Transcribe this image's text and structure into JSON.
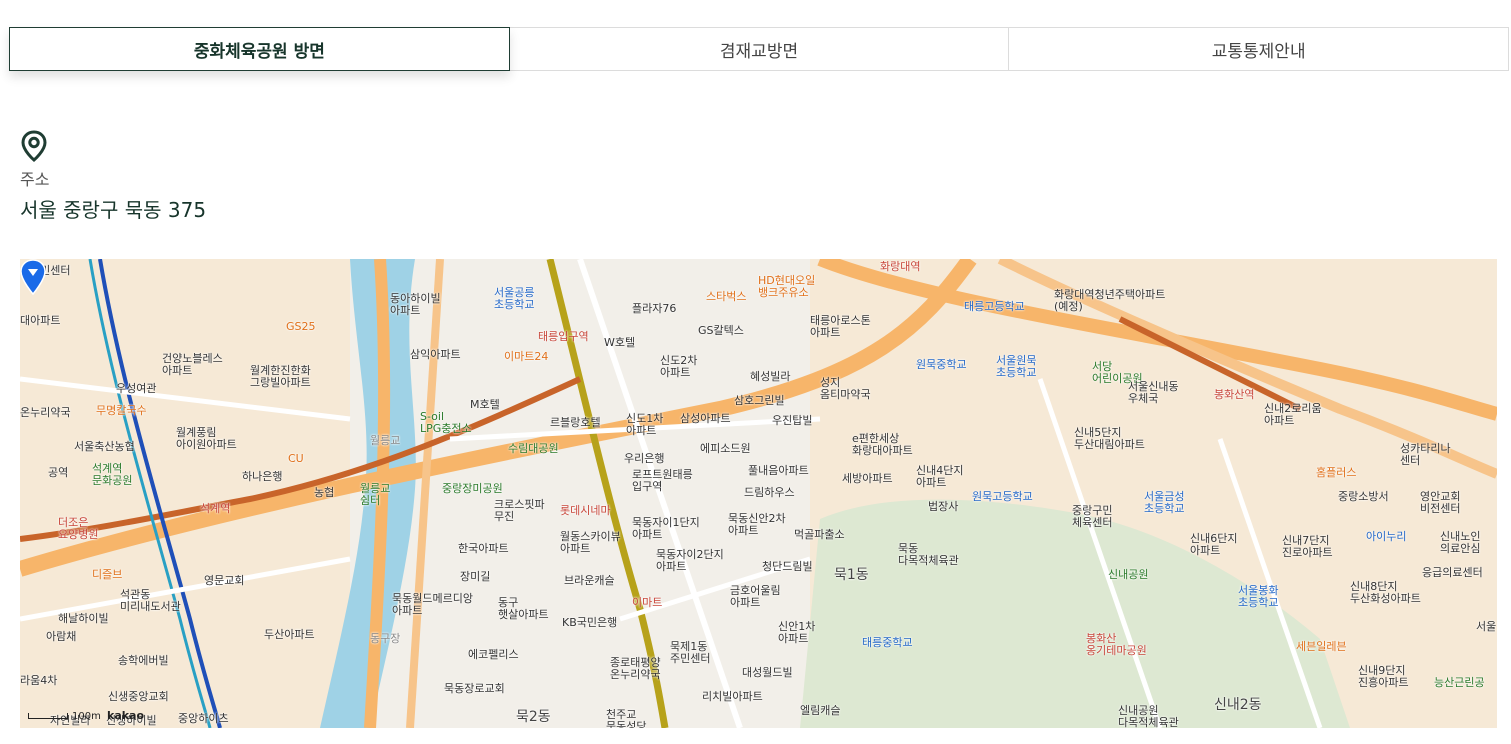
{
  "tabs": [
    {
      "label": "중화체육공원 방면",
      "active": true
    },
    {
      "label": "겸재교방면",
      "active": false
    },
    {
      "label": "교통통제안내",
      "active": false
    }
  ],
  "address": {
    "icon": "location-pin-icon",
    "label": "주소",
    "value": "서울 중랑구 묵동 375"
  },
  "map": {
    "provider": "kakao",
    "scale": "100m",
    "labels": {
      "jumin": "주민센터",
      "apt1": "대아파트",
      "gs25": "GS25",
      "dongahai": "동아하이빌\n아파트",
      "seoulgongneung": "서울공릉\n초등학교",
      "plaza76": "플라자76",
      "starbucks": "스타벅스",
      "hdoil": "HD현대오일\n뱅크주유소",
      "taereungst": "태릉입구역",
      "hwarangst": "화랑대역",
      "taereunghs": "태릉고등학교",
      "hwarangapt": "화랑대역청년주택아파트\n(예정)",
      "emart24": "이마트24",
      "samik": "삼익아파트",
      "gunyang": "건양노블레스\n아파트",
      "wolgye": "월계한진한화\n그랑빌아파트",
      "woosung": "우성여관",
      "onnuri": "온누리약국",
      "mumyung": "무명칼국수",
      "wolgyepung": "월계풍림\n아이원아파트",
      "soilgas": "S-oil\nLPG충전소",
      "mhotel": "M호텔",
      "whotel": "W호텔",
      "gscaltex": "GS칼텍스",
      "sindo2": "신도2차\n아파트",
      "haesung": "혜성빌라",
      "taereungrosten": "태릉아로스톤\n아파트",
      "wonmukms": "원묵중학교",
      "seoulwonmuk": "서울원묵\n초등학교",
      "seodang": "서당\n어린이공원",
      "sinnaedong": "서울신내동\n우체국",
      "bonghwa": "봉화산역",
      "sinnae2": "신내2로리움\n아파트",
      "seoulnong": "서울축산농협",
      "cu": "CU",
      "nonghyup": "농협",
      "hanabank": "하나은행",
      "suksgye": "석계역\n문화공원",
      "seokgyest": "석계역",
      "gongyeok": "공역",
      "wolleunggyo": "월릉교",
      "wolleungshelter": "월릉교\n쉼터",
      "suim": "수림대공원",
      "rueblanc": "르블랑호텔",
      "sindo1": "신도1차\n아파트",
      "samsung": "삼성아파트",
      "samho": "삼호그린빌",
      "seongji": "성지\n옴티마약국",
      "woojin": "우진탑빌",
      "epyeonhan": "e편한세상\n화랑대아파트",
      "sinnae5": "신내5단지\n두산대림아파트",
      "seongkatari": "성카타리나\n센터",
      "woori": "우리은행",
      "lotteworld": "로프트원태릉\n입구역",
      "epis": "에피소드원",
      "pulnae": "풀내음아파트",
      "dreamhouse": "드림하우스",
      "sinnae4": "신내4단지\n아파트",
      "sebang": "세방아파트",
      "homeplus": "홈플러스",
      "junghwa": "중랑장미공원",
      "crosspark": "크로스핏파\n무진",
      "lotte": "롯데시네마",
      "mukdong1": "묵동자이1단지\n아파트",
      "mukdong2a": "묵동신안2차\n아파트",
      "bupjangsa": "법장사",
      "wonmukhs": "원묵고등학교",
      "jungranggu": "중랑구민\n체육센터",
      "seoulgeumseong": "서울금성\n초등학교",
      "sinnae6": "신내6단지\n아파트",
      "sinnae7": "신내7단지\n진로아파트",
      "jungrangsobang": "중랑소방서",
      "youngkwang": "영안교회\n비전센터",
      "sinnae_center": "신내노인\n의료안심",
      "demo": "더조은\n요양병원",
      "hanguk": "한국아파트",
      "wolldong": "월동스카이뷰\n아파트",
      "mukdong2": "묵동자이2단지\n아파트",
      "mukgolpa": "먹골파출소",
      "mukdongsports": "묵동\n다목적체육관",
      "mukdong1dong": "묵1동",
      "sinnaepark": "신내공원",
      "ailuri": "아이누리",
      "dizzle": "디즐브",
      "seokgwan": "석관동\n미리내도서관",
      "youngmun": "영문교회",
      "jangmi": "장미길",
      "brown": "브라운캐슬",
      "emart": "이마트",
      "cheongdan": "청단드림빌",
      "seoulbonghwa": "서울봉화\n초등학교",
      "sinnae8": "신내8단지\n두산화성아파트",
      "emergency": "응급의료센터",
      "haenal": "해날하이빌",
      "araechae": "아람채",
      "dusan": "두산아파트",
      "mukdongworld": "묵동월드메르디앙\n아파트",
      "donggu": "동구\n햇살아파트",
      "kbbank": "KB국민은행",
      "geumho": "금호어울림\n아파트",
      "sinan1": "신안1차\n아파트",
      "taereungms": "태릉중학교",
      "bonghwasan": "봉화산\n옹기테마공원",
      "serbang": "세븐일레븐",
      "seoul": "서울",
      "songhak": "송학에버빌",
      "ecopalace": "에코펠리스",
      "mukje1": "묵제1동\n주민센터",
      "daesung": "대성월드빌",
      "sinnae9": "신내9단지\n진흥아파트",
      "neungsan": "능산근린공",
      "arahae4": "라움4차",
      "sinsaeng": "신생중앙교회",
      "mukdongjang": "묵동장로교회",
      "jongro": "종로태평양\n온누리약국",
      "richbil": "리치빌아파트",
      "muk2dong": "묵2동",
      "cheonju": "천주교\n묵동성당",
      "ellim": "엘림캐슬",
      "sinnae2dong": "신내2동",
      "sinnaesports": "신내공원\n다목적체육관",
      "joongang": "중앙하이츠",
      "jayeon": "자연빌라",
      "sinsaeng2": "신생하이빌",
      "dongujang": "동구장"
    }
  }
}
